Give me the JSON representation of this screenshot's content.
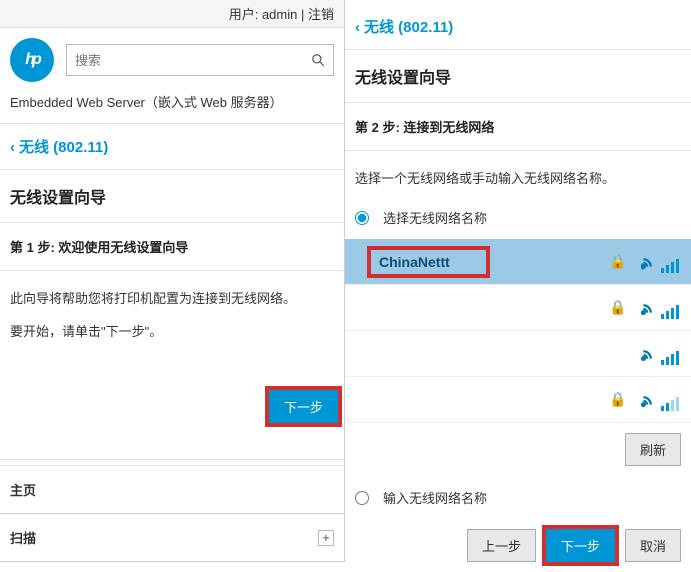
{
  "left": {
    "user_label": "用户: ",
    "user": "admin",
    "sep": " | ",
    "logout": "注销",
    "logo_text": "hp",
    "search_placeholder": "搜索",
    "ews": "Embedded Web Server（嵌入式 Web 服务器）",
    "bc_chevron": "‹",
    "bc_text": "无线 (802.11)",
    "wizard_title": "无线设置向导",
    "step": "第 1 步: 欢迎使用无线设置向导",
    "body1": "此向导将帮助您将打印机配置为连接到无线网络。",
    "body2": "要开始，请单击\"下一步\"。",
    "next": "下一步",
    "home": "主页",
    "scan": "扫描"
  },
  "right": {
    "bc_chevron": "‹",
    "bc_text": "无线 (802.11)",
    "wizard_title": "无线设置向导",
    "step": "第 2 步: 连接到无线网络",
    "intro": "选择一个无线网络或手动输入无线网络名称。",
    "radio_select": "选择无线网络名称",
    "radio_manual": "输入无线网络名称",
    "networks": [
      {
        "name": "ChinaNettt",
        "locked": true,
        "bars": 4,
        "selected": true,
        "highlight": true
      },
      {
        "name": "",
        "locked": true,
        "bars": 4,
        "selected": false,
        "highlight": false
      },
      {
        "name": "",
        "locked": false,
        "bars": 4,
        "selected": false,
        "highlight": false
      },
      {
        "name": "",
        "locked": true,
        "bars": 2,
        "selected": false,
        "highlight": false
      }
    ],
    "refresh": "刷新",
    "prev": "上一步",
    "next": "下一步",
    "cancel": "取消"
  }
}
